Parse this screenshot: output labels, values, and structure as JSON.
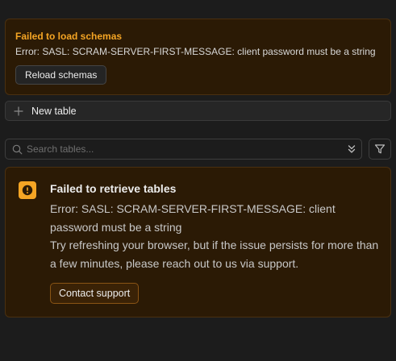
{
  "schema_error": {
    "title": "Failed to load schemas",
    "message": "Error: SASL: SCRAM-SERVER-FIRST-MESSAGE: client password must be a string",
    "reload_label": "Reload schemas"
  },
  "new_table": {
    "label": "New table",
    "icon": "plus-icon"
  },
  "search": {
    "placeholder": "Search tables...",
    "value": "",
    "icons": {
      "search": "search-icon",
      "sort": "chevrons-up-down-icon",
      "filter": "filter-icon"
    }
  },
  "tables_error": {
    "title": "Failed to retrieve tables",
    "message": "Error: SASL: SCRAM-SERVER-FIRST-MESSAGE: client password must be a string",
    "hint": "Try refreshing your browser, but if the issue persists for more than a few minutes, please reach out to us via support.",
    "contact_label": "Contact support",
    "icon": "warning-circle-icon"
  },
  "colors": {
    "background": "#1c1c1c",
    "warning_bg": "#2b1a05",
    "warning_border": "#4a3010",
    "warning_accent": "#f5a524"
  }
}
